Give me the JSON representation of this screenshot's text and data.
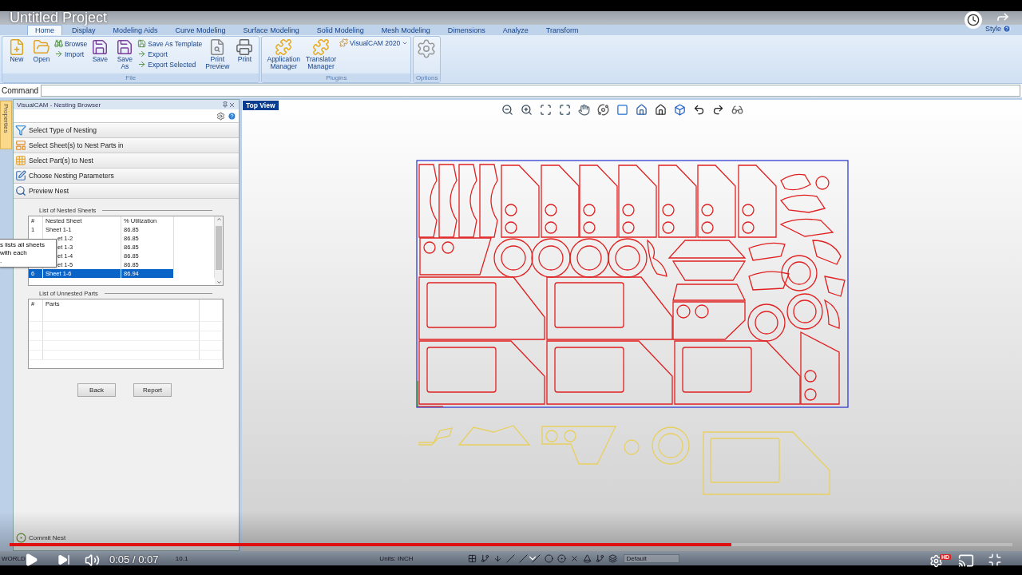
{
  "video": {
    "title": "Untitled Project",
    "time": "0:05 / 0:07",
    "progress": {
      "level": 0.72
    },
    "badge": "HD"
  },
  "ribbon": {
    "tabs": [
      {
        "label": "Home",
        "selected": true
      },
      {
        "label": "Display",
        "selected": false
      },
      {
        "label": "Modeling Aids",
        "selected": false
      },
      {
        "label": "Curve Modeling",
        "selected": false
      },
      {
        "label": "Surface Modeling",
        "selected": false
      },
      {
        "label": "Solid Modeling",
        "selected": false
      },
      {
        "label": "Mesh Modeling",
        "selected": false
      },
      {
        "label": "Dimensions",
        "selected": false
      },
      {
        "label": "Analyze",
        "selected": false
      },
      {
        "label": "Transform",
        "selected": false
      }
    ],
    "style_menu": "Style",
    "groups": [
      {
        "label": "File",
        "items": [
          {
            "kind": "large",
            "lines": [
              "New"
            ]
          },
          {
            "kind": "large",
            "lines": [
              "Open"
            ]
          },
          {
            "kind": "stack",
            "items": [
              "Browse",
              "Import"
            ]
          },
          {
            "kind": "large",
            "lines": [
              "Save"
            ]
          },
          {
            "kind": "large",
            "lines": [
              "Save",
              "As"
            ]
          },
          {
            "kind": "stack",
            "items": [
              "Save As Template",
              "Export",
              "Export Selected"
            ]
          },
          {
            "kind": "large",
            "lines": [
              "Print",
              "Preview"
            ]
          },
          {
            "kind": "large",
            "lines": [
              "Print"
            ]
          }
        ]
      },
      {
        "label": "Plugins",
        "items": [
          {
            "kind": "large",
            "lines": [
              "Application",
              "Manager"
            ]
          },
          {
            "kind": "large",
            "lines": [
              "Translator",
              "Manager"
            ]
          },
          {
            "kind": "dropdown",
            "label": "VisualCAM 2020"
          }
        ]
      },
      {
        "label": "Options",
        "items": [
          {
            "kind": "gear"
          }
        ]
      }
    ]
  },
  "command": {
    "label": "Command"
  },
  "side_tab": "Properties",
  "panel": {
    "title": "VisualCAM - Nesting Browser",
    "steps": [
      "Select Type of Nesting",
      "Select Sheet(s) to Nest Parts in",
      "Select Part(s) to Nest",
      "Choose Nesting Parameters",
      "Preview Nest"
    ],
    "nested": {
      "label": "List of Nested Sheets",
      "columns": [
        "#",
        "Nested Sheet",
        "% Utilization"
      ],
      "rows": [
        {
          "number": "1",
          "sheet": "Sheet 1-1",
          "utilization": "86.85",
          "selected": false
        },
        {
          "sheet": "et 1-2",
          "utilization": "86.85",
          "selected": false
        },
        {
          "sheet": "et 1-3",
          "utilization": "86.85",
          "selected": false
        },
        {
          "sheet": "et 1-4",
          "utilization": "86.85",
          "selected": false
        },
        {
          "sheet": "et 1-5",
          "utilization": "86.85",
          "selected": false
        },
        {
          "number": "6",
          "sheet": "Sheet 1-6",
          "utilization": "86.94",
          "selected": true
        }
      ]
    },
    "unnested": {
      "label": "List of Unnested Parts",
      "columns": [
        "#",
        "Parts"
      ]
    },
    "buttons": [
      "Back",
      "Report"
    ],
    "commit": "Commit Nest",
    "tooltip": [
      "s lists all sheets",
      "with each",
      "."
    ]
  },
  "viewport": {
    "label": "Top View"
  },
  "status_bar": {
    "fields": [
      "WORLD",
      "10.1",
      "Units: INCH"
    ],
    "layer": "Default"
  }
}
